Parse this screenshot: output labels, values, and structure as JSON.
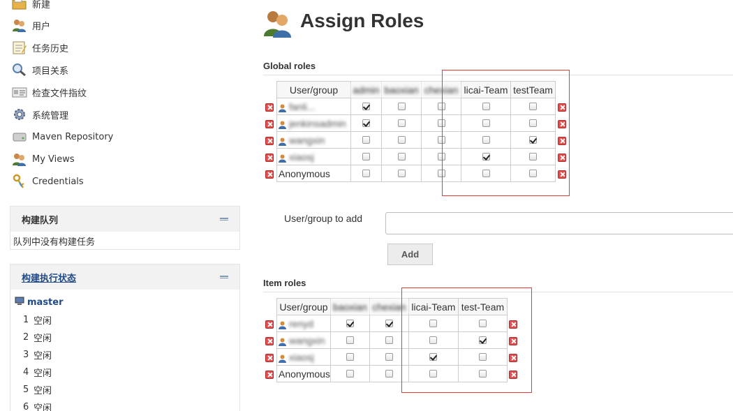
{
  "sidebar": {
    "tasks": [
      {
        "label": "新建",
        "icon": "new-folder-icon"
      },
      {
        "label": "用户",
        "icon": "users-icon"
      },
      {
        "label": "任务历史",
        "icon": "notepad-icon"
      },
      {
        "label": "项目关系",
        "icon": "magnifier-icon"
      },
      {
        "label": "检查文件指纹",
        "icon": "fingerprint-icon"
      },
      {
        "label": "系统管理",
        "icon": "gear-icon"
      },
      {
        "label": "Maven Repository",
        "icon": "drive-icon"
      },
      {
        "label": "My Views",
        "icon": "users-icon"
      },
      {
        "label": "Credentials",
        "icon": "keys-icon"
      }
    ],
    "build_queue": {
      "title": "构建队列",
      "empty_text": "队列中没有构建任务"
    },
    "executors": {
      "title": "构建执行状态",
      "node": "master",
      "rows": [
        {
          "num": "1",
          "status": "空闲"
        },
        {
          "num": "2",
          "status": "空闲"
        },
        {
          "num": "3",
          "status": "空闲"
        },
        {
          "num": "4",
          "status": "空闲"
        },
        {
          "num": "5",
          "status": "空闲"
        },
        {
          "num": "6",
          "status": "空闲"
        }
      ]
    }
  },
  "main": {
    "title": "Assign Roles",
    "global_roles": {
      "heading": "Global roles",
      "columns": [
        "User/group",
        "admin",
        "baoxian",
        "chexian",
        "licai-Team",
        "testTeam"
      ],
      "rows": [
        {
          "name": "fanli...",
          "user": true,
          "checked": [
            true,
            false,
            false,
            false,
            false
          ]
        },
        {
          "name": "jenkinsadmin",
          "user": true,
          "checked": [
            true,
            false,
            false,
            false,
            false
          ]
        },
        {
          "name": "wangxin",
          "user": true,
          "checked": [
            false,
            false,
            false,
            false,
            true
          ]
        },
        {
          "name": "xiaosj",
          "user": true,
          "checked": [
            false,
            false,
            false,
            true,
            false
          ]
        },
        {
          "name": "Anonymous",
          "user": false,
          "checked": [
            false,
            false,
            false,
            false,
            false
          ]
        }
      ]
    },
    "add_user": {
      "label": "User/group to add",
      "value": "",
      "button": "Add"
    },
    "item_roles": {
      "heading": "Item roles",
      "columns": [
        "User/group",
        "baoxian",
        "chexian",
        "licai-Team",
        "test-Team"
      ],
      "rows": [
        {
          "name": "renyd",
          "user": true,
          "checked": [
            true,
            true,
            false,
            false
          ]
        },
        {
          "name": "wangxin",
          "user": true,
          "checked": [
            false,
            false,
            false,
            true
          ]
        },
        {
          "name": "xiaosj",
          "user": true,
          "checked": [
            false,
            false,
            true,
            false
          ]
        },
        {
          "name": "Anonymous",
          "user": false,
          "checked": [
            false,
            false,
            false,
            false
          ]
        }
      ]
    }
  },
  "colors": {
    "accent": "#204a87",
    "highlight_box": "#e23b3b",
    "delete": "#e05050"
  }
}
